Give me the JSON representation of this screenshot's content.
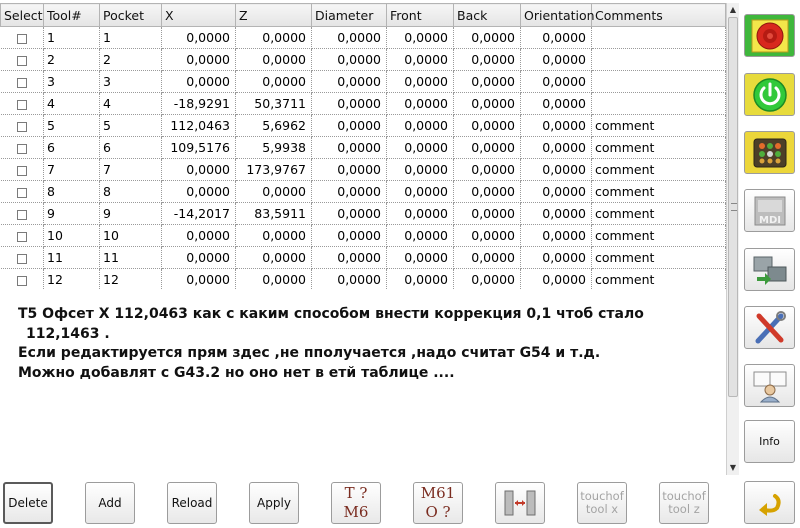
{
  "table": {
    "headers": [
      "Select",
      "Tool#",
      "Pocket",
      "X",
      "Z",
      "Diameter",
      "Front",
      "Back",
      "Orientation",
      "Comments"
    ],
    "rows": [
      {
        "tool": "1",
        "pocket": "1",
        "x": "0,0000",
        "z": "0,0000",
        "diameter": "0,0000",
        "front": "0,0000",
        "back": "0,0000",
        "orientation": "0,0000",
        "comment": ""
      },
      {
        "tool": "2",
        "pocket": "2",
        "x": "0,0000",
        "z": "0,0000",
        "diameter": "0,0000",
        "front": "0,0000",
        "back": "0,0000",
        "orientation": "0,0000",
        "comment": ""
      },
      {
        "tool": "3",
        "pocket": "3",
        "x": "0,0000",
        "z": "0,0000",
        "diameter": "0,0000",
        "front": "0,0000",
        "back": "0,0000",
        "orientation": "0,0000",
        "comment": ""
      },
      {
        "tool": "4",
        "pocket": "4",
        "x": "-18,9291",
        "z": "50,3711",
        "diameter": "0,0000",
        "front": "0,0000",
        "back": "0,0000",
        "orientation": "0,0000",
        "comment": ""
      },
      {
        "tool": "5",
        "pocket": "5",
        "x": "112,0463",
        "z": "5,6962",
        "diameter": "0,0000",
        "front": "0,0000",
        "back": "0,0000",
        "orientation": "0,0000",
        "comment": "comment"
      },
      {
        "tool": "6",
        "pocket": "6",
        "x": "109,5176",
        "z": "5,9938",
        "diameter": "0,0000",
        "front": "0,0000",
        "back": "0,0000",
        "orientation": "0,0000",
        "comment": "comment"
      },
      {
        "tool": "7",
        "pocket": "7",
        "x": "0,0000",
        "z": "173,9767",
        "diameter": "0,0000",
        "front": "0,0000",
        "back": "0,0000",
        "orientation": "0,0000",
        "comment": "comment"
      },
      {
        "tool": "8",
        "pocket": "8",
        "x": "0,0000",
        "z": "0,0000",
        "diameter": "0,0000",
        "front": "0,0000",
        "back": "0,0000",
        "orientation": "0,0000",
        "comment": "comment"
      },
      {
        "tool": "9",
        "pocket": "9",
        "x": "-14,2017",
        "z": "83,5911",
        "diameter": "0,0000",
        "front": "0,0000",
        "back": "0,0000",
        "orientation": "0,0000",
        "comment": "comment"
      },
      {
        "tool": "10",
        "pocket": "10",
        "x": "0,0000",
        "z": "0,0000",
        "diameter": "0,0000",
        "front": "0,0000",
        "back": "0,0000",
        "orientation": "0,0000",
        "comment": "comment"
      },
      {
        "tool": "11",
        "pocket": "11",
        "x": "0,0000",
        "z": "0,0000",
        "diameter": "0,0000",
        "front": "0,0000",
        "back": "0,0000",
        "orientation": "0,0000",
        "comment": "comment"
      },
      {
        "tool": "12",
        "pocket": "12",
        "x": "0,0000",
        "z": "0,0000",
        "diameter": "0,0000",
        "front": "0,0000",
        "back": "0,0000",
        "orientation": "0,0000",
        "comment": "comment"
      }
    ]
  },
  "note": {
    "line1": "T5 Офсет X 112,0463 как с каким способом внести коррекция 0,1 чтоб стало",
    "line2": "112,1463  .",
    "line3": "Если редактируется прям здес ,не пполучается ,надо считат  G54 и т.д.",
    "line4": "Можно добавлят с G43.2 но оно нет в етй таблице ...."
  },
  "bottom": {
    "delete": "Delete",
    "add": "Add",
    "reload": "Reload",
    "apply": "Apply",
    "m6_top": "T ?",
    "m6_bottom": "M6",
    "m61_top": "M61",
    "m61_bottom": "O ?",
    "touchoff_x_1": "touchof",
    "touchoff_x_2": "tool x",
    "touchoff_z_1": "touchof",
    "touchoff_z_2": "tool z"
  },
  "side": {
    "info": "Info",
    "mdi_label": "MDI"
  },
  "icons": {
    "estop": "emergency-stop-icon",
    "power": "power-icon",
    "manual": "manual-mode-icon",
    "mdi": "mdi-icon",
    "auto": "auto-mode-icon",
    "settings": "tools-settings-icon",
    "user": "user-icon",
    "back": "back-arrow-icon",
    "chuck": "chuck-icon"
  },
  "colors": {
    "active_green": "#3fb73c",
    "estop_red": "#d8281e",
    "power_green": "#31c93a",
    "panel_yellow": "#ecd63a"
  }
}
